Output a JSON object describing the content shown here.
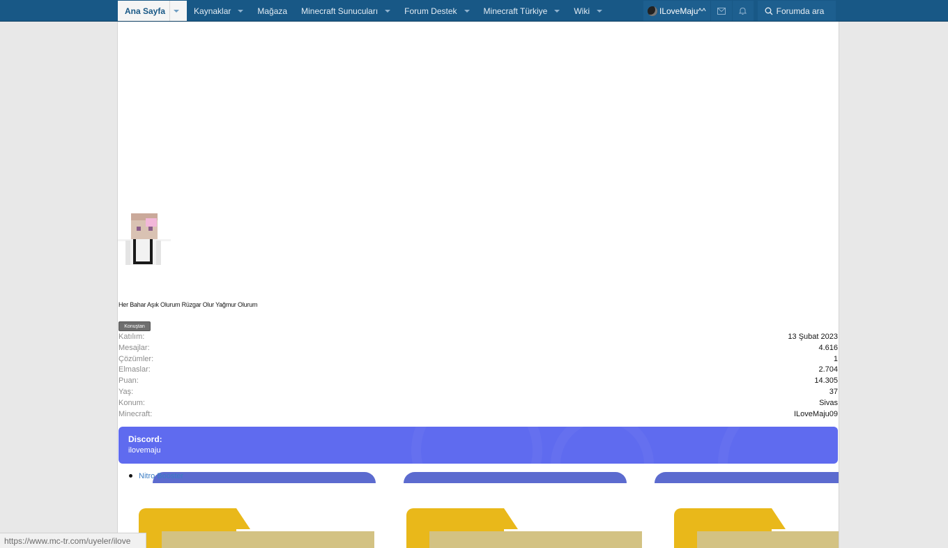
{
  "nav": {
    "tabs": [
      {
        "label": "Ana Sayfa",
        "active": true,
        "dropdown": true
      },
      {
        "label": "Kaynaklar",
        "dropdown": true
      },
      {
        "label": "Mağaza",
        "dropdown": false
      },
      {
        "label": "Minecraft Sunucuları",
        "dropdown": true
      },
      {
        "label": "Forum Destek",
        "dropdown": true
      },
      {
        "label": "Minecraft Türkiye",
        "dropdown": true
      },
      {
        "label": "Wiki",
        "dropdown": true
      }
    ],
    "user": {
      "name": "ILoveMaju^^"
    },
    "icons": [
      "envelope-icon",
      "bell-icon",
      "search-icon"
    ],
    "search_label": "Forumda ara"
  },
  "profile": {
    "status_text": "Her Bahar Aşık Olurum Rüzgar Olur Yağmur Olurum",
    "badge": "Konuştan",
    "stats": [
      {
        "label": "Katılım:",
        "value": "13 Şubat 2023"
      },
      {
        "label": "Mesajlar:",
        "value": "4.616"
      },
      {
        "label": "Çözümler:",
        "value": "1"
      },
      {
        "label": "Elmaslar:",
        "value": "2.704"
      },
      {
        "label": "Puan:",
        "value": "14.305"
      },
      {
        "label": "Yaş:",
        "value": "37"
      },
      {
        "label": "Konum:",
        "value": "Sivas"
      },
      {
        "label": "Minecraft:",
        "value": "ILoveMaju09"
      }
    ],
    "discord": {
      "label": "Discord:",
      "value": "ilovemaju"
    },
    "nitro_alt": "Nitro Booster"
  },
  "statusbar": {
    "url": "https://www.mc-tr.com/uyeler/ilove"
  },
  "colors": {
    "nav_bg": "#185886",
    "discord_bg": "#5f6bef",
    "folder_yellow": "#e9b81a",
    "folder_front": "#d3c283",
    "nitro_arch": "#5c6bcf"
  }
}
